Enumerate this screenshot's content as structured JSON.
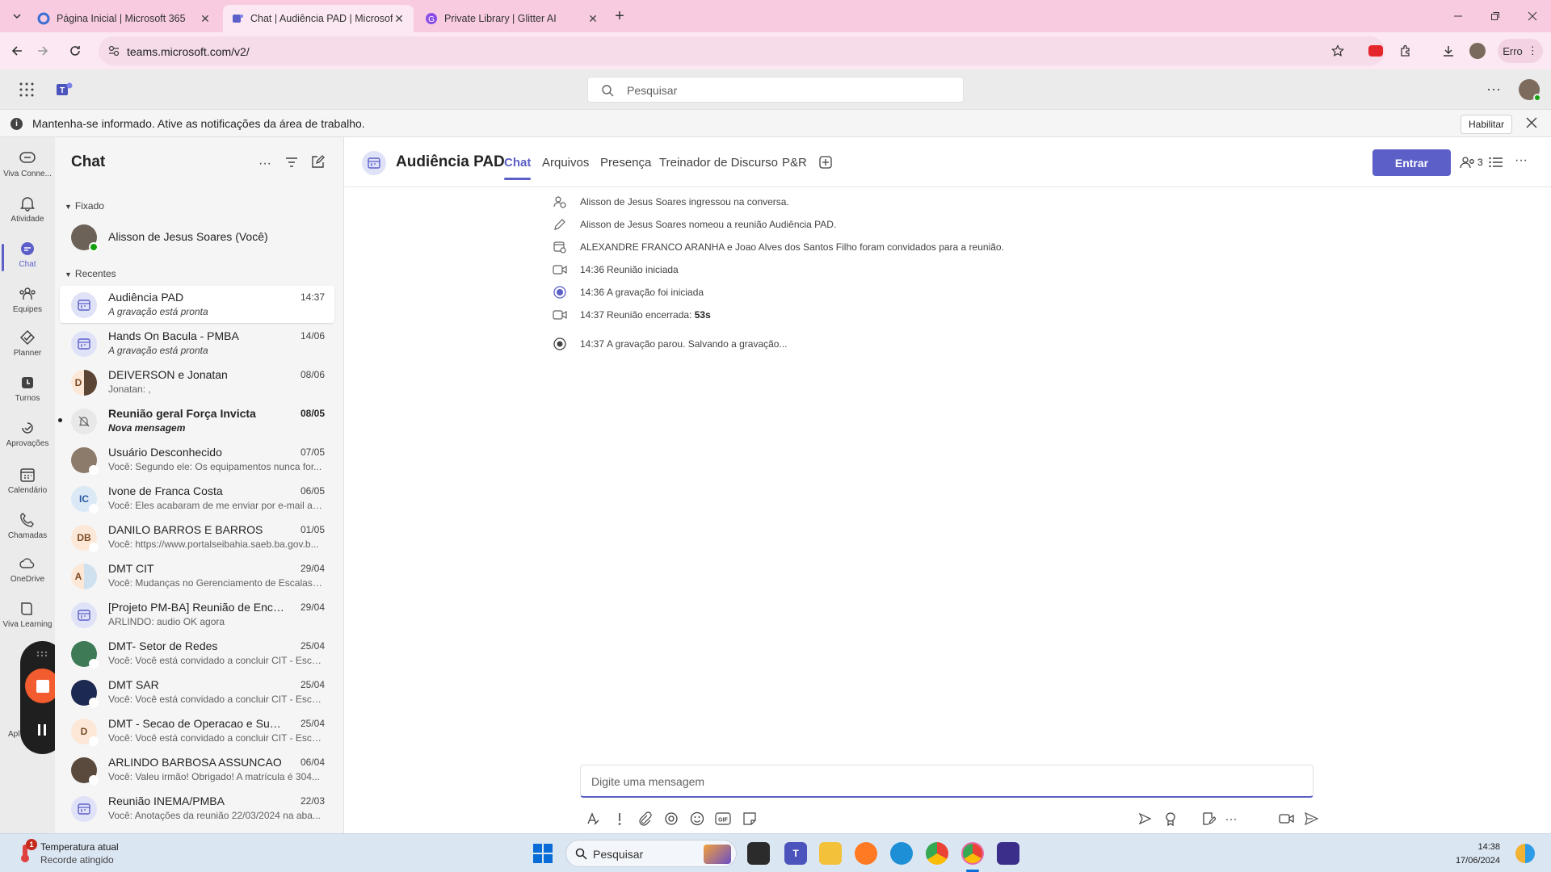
{
  "browser": {
    "tabs": [
      {
        "title": "Página Inicial | Microsoft 365",
        "active": false
      },
      {
        "title": "Chat | Audiência PAD | Microsoft Teams",
        "active": true
      },
      {
        "title": "Private Library | Glitter AI",
        "active": false
      }
    ],
    "url": "teams.microsoft.com/v2/",
    "profile_label": "Erro"
  },
  "teams_header": {
    "search_placeholder": "Pesquisar"
  },
  "notification": {
    "text": "Mantenha-se informado. Ative as notificações da área de trabalho.",
    "button_label": "Habilitar"
  },
  "rail": {
    "items": [
      {
        "label": "Viva Conne...",
        "icon": "viva-connections-icon"
      },
      {
        "label": "Atividade",
        "icon": "bell-icon"
      },
      {
        "label": "Chat",
        "icon": "chat-icon",
        "active": true
      },
      {
        "label": "Equipes",
        "icon": "teams-icon"
      },
      {
        "label": "Planner",
        "icon": "planner-icon"
      },
      {
        "label": "Turnos",
        "icon": "shifts-icon"
      },
      {
        "label": "Aprovações",
        "icon": "approvals-icon"
      },
      {
        "label": "Calendário",
        "icon": "calendar-icon"
      },
      {
        "label": "Chamadas",
        "icon": "phone-icon"
      },
      {
        "label": "OneDrive",
        "icon": "cloud-icon"
      },
      {
        "label": "Viva Learning",
        "icon": "learning-icon"
      },
      {
        "label": "Apl",
        "icon": "apps-icon"
      }
    ]
  },
  "chatlist": {
    "title": "Chat",
    "pinned_header": "Fixado",
    "recent_header": "Recentes",
    "pinned": [
      {
        "name": "Alisson de Jesus Soares (Você)"
      }
    ],
    "recent": [
      {
        "name": "Audiência PAD",
        "time": "14:37",
        "preview": "A gravação está pronta"
      },
      {
        "name": "Hands On Bacula - PMBA",
        "time": "14/06",
        "preview": "A gravação está pronta"
      },
      {
        "name": "DEIVERSON e Jonatan",
        "time": "08/06",
        "preview": "Jonatan: ,",
        "initial": "D"
      },
      {
        "name": "Reunião geral Força Invicta",
        "time": "08/05",
        "preview": "Nova mensagem"
      },
      {
        "name": "Usuário Desconhecido",
        "time": "07/05",
        "preview": "Você: Segundo ele: Os equipamentos nunca for..."
      },
      {
        "name": "Ivone de Franca Costa",
        "time": "06/05",
        "preview": "Você: Eles acabaram de me enviar por e-mail a ...",
        "initial": "IC"
      },
      {
        "name": "DANILO BARROS E BARROS",
        "time": "01/05",
        "preview": "Você: https://www.portalseibahia.saeb.ba.gov.b...",
        "initial": "DB"
      },
      {
        "name": "DMT CIT",
        "time": "29/04",
        "preview": "Você: Mudanças no Gerenciamento de Escalas ...",
        "initial": "A"
      },
      {
        "name": "[Projeto PM-BA] Reunião de Encer...",
        "time": "29/04",
        "preview": "ARLINDO: audio OK agora"
      },
      {
        "name": "DMT- Setor de Redes",
        "time": "25/04",
        "preview": "Você: Você está convidado a concluir CIT - Escu..."
      },
      {
        "name": "DMT SAR",
        "time": "25/04",
        "preview": "Você: Você está convidado a concluir CIT - Escu..."
      },
      {
        "name": "DMT - Secao de Operacao e Supo...",
        "time": "25/04",
        "preview": "Você: Você está convidado a concluir CIT - Escu...",
        "initial": "D"
      },
      {
        "name": "ARLINDO BARBOSA ASSUNCAO",
        "time": "06/04",
        "preview": "Você: Valeu irmão! Obrigado! A matrícula é 304..."
      },
      {
        "name": "Reunião INEMA/PMBA",
        "time": "22/03",
        "preview": "Você: Anotações da reunião 22/03/2024 na aba..."
      }
    ]
  },
  "main": {
    "title": "Audiência PAD",
    "tabs": [
      "Chat",
      "Arquivos",
      "Presença",
      "Treinador de Discurso",
      "P&R"
    ],
    "join_label": "Entrar",
    "participants_count": "3",
    "events": [
      {
        "time": "",
        "text": "Alisson de Jesus Soares ingressou na conversa.",
        "icon": "person-add-icon"
      },
      {
        "time": "",
        "text": "Alisson de Jesus Soares nomeou a reunião Audiência PAD.",
        "icon": "pencil-icon"
      },
      {
        "time": "",
        "text": "ALEXANDRE FRANCO ARANHA e Joao Alves dos Santos Filho foram convidados para a reunião.",
        "icon": "calendar-add-icon"
      },
      {
        "time": "14:36",
        "text": "Reunião iniciada",
        "icon": "video-icon"
      },
      {
        "time": "14:36",
        "text": "A gravação foi iniciada",
        "icon": "record-icon"
      },
      {
        "time": "14:37",
        "text": "Reunião encerrada:",
        "bold": "53s",
        "icon": "video-icon"
      },
      {
        "time": "14:37",
        "text": "A gravação parou. Salvando a gravação...",
        "icon": "record-stop-icon"
      }
    ],
    "composer_placeholder": "Digite uma mensagem"
  },
  "taskbar": {
    "weather_title": "Temperatura atual",
    "weather_sub": "Recorde atingido",
    "weather_badge": "1",
    "search_placeholder": "Pesquisar",
    "time": "14:38",
    "date": "17/06/2024"
  },
  "colors": {
    "brand": "#5b5fc7",
    "tabstrip": "#f8cbe1",
    "record": "#f25c2f"
  }
}
